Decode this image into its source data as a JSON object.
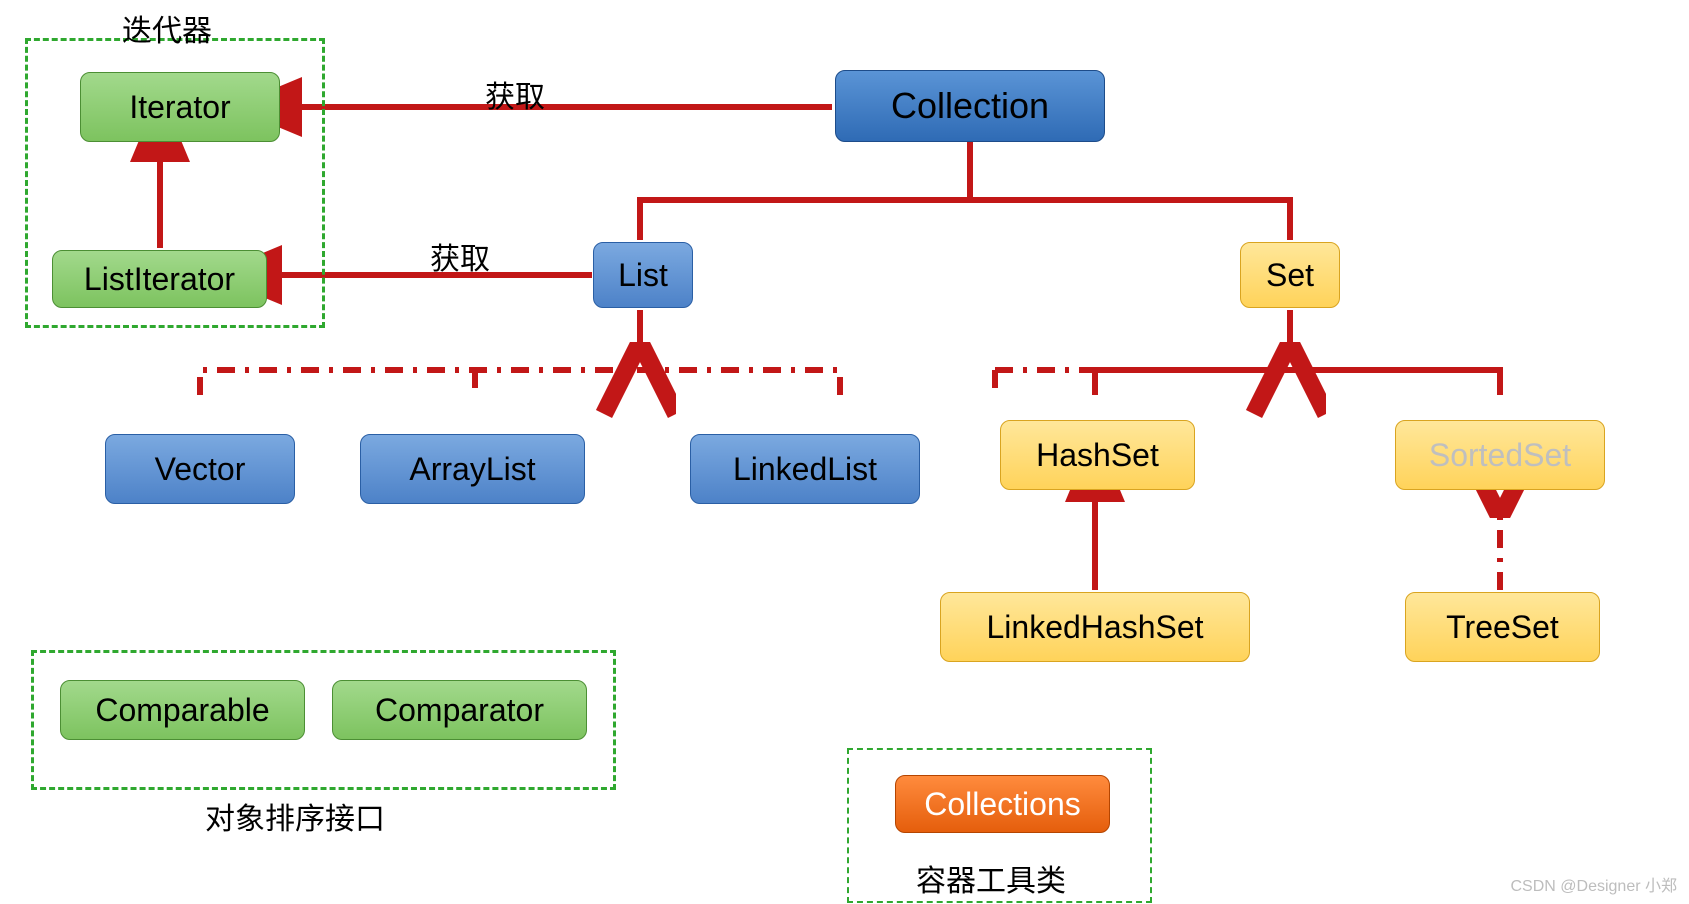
{
  "nodes": {
    "collection": {
      "label": "Collection"
    },
    "list": {
      "label": "List"
    },
    "set": {
      "label": "Set"
    },
    "vector": {
      "label": "Vector"
    },
    "arraylist": {
      "label": "ArrayList"
    },
    "linkedlist": {
      "label": "LinkedList"
    },
    "hashset": {
      "label": "HashSet"
    },
    "sortedset": {
      "label": "SortedSet"
    },
    "linkedhashset": {
      "label": "LinkedHashSet"
    },
    "treeset": {
      "label": "TreeSet"
    },
    "iterator": {
      "label": "Iterator"
    },
    "listiterator": {
      "label": "ListIterator"
    },
    "comparable": {
      "label": "Comparable"
    },
    "comparator": {
      "label": "Comparator"
    },
    "collections": {
      "label": "Collections"
    }
  },
  "labels": {
    "iteratorGroup": "迭代器",
    "sortGroup": "对象排序接口",
    "toolGroup": "容器工具类",
    "obtain1": "获取",
    "obtain2": "获取"
  },
  "watermark": "CSDN @Designer 小郑",
  "colors": {
    "arrow": "#c21717"
  }
}
